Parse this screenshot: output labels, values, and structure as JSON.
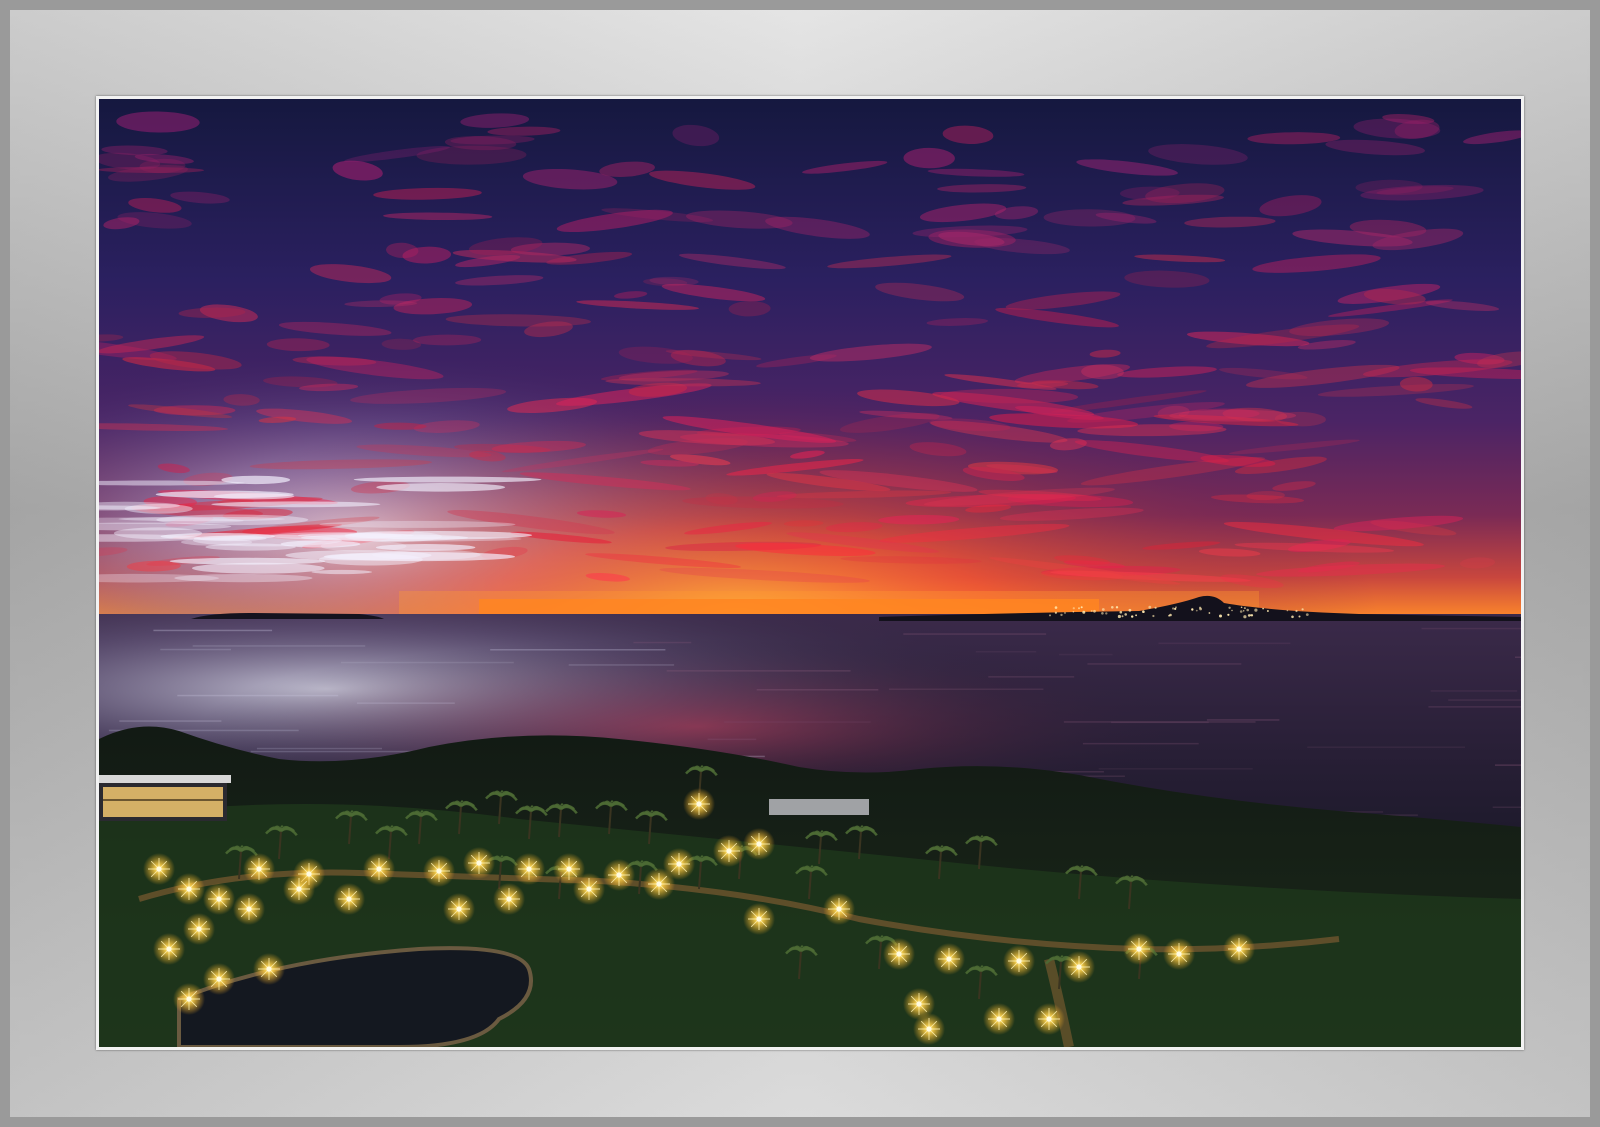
{
  "photo": {
    "subject": "",
    "colors": {
      "frame_light": "#e3e3e3",
      "frame_dark": "#b7b7b7",
      "sky_top": "#1a1d4a",
      "sky_mid": "#3b2266",
      "cloud_red": "#b8305a",
      "horizon_orange": "#ff7a1a",
      "sea": "#2a1c3a",
      "land": "#0f1410",
      "lamp": "#ffd34d"
    }
  }
}
